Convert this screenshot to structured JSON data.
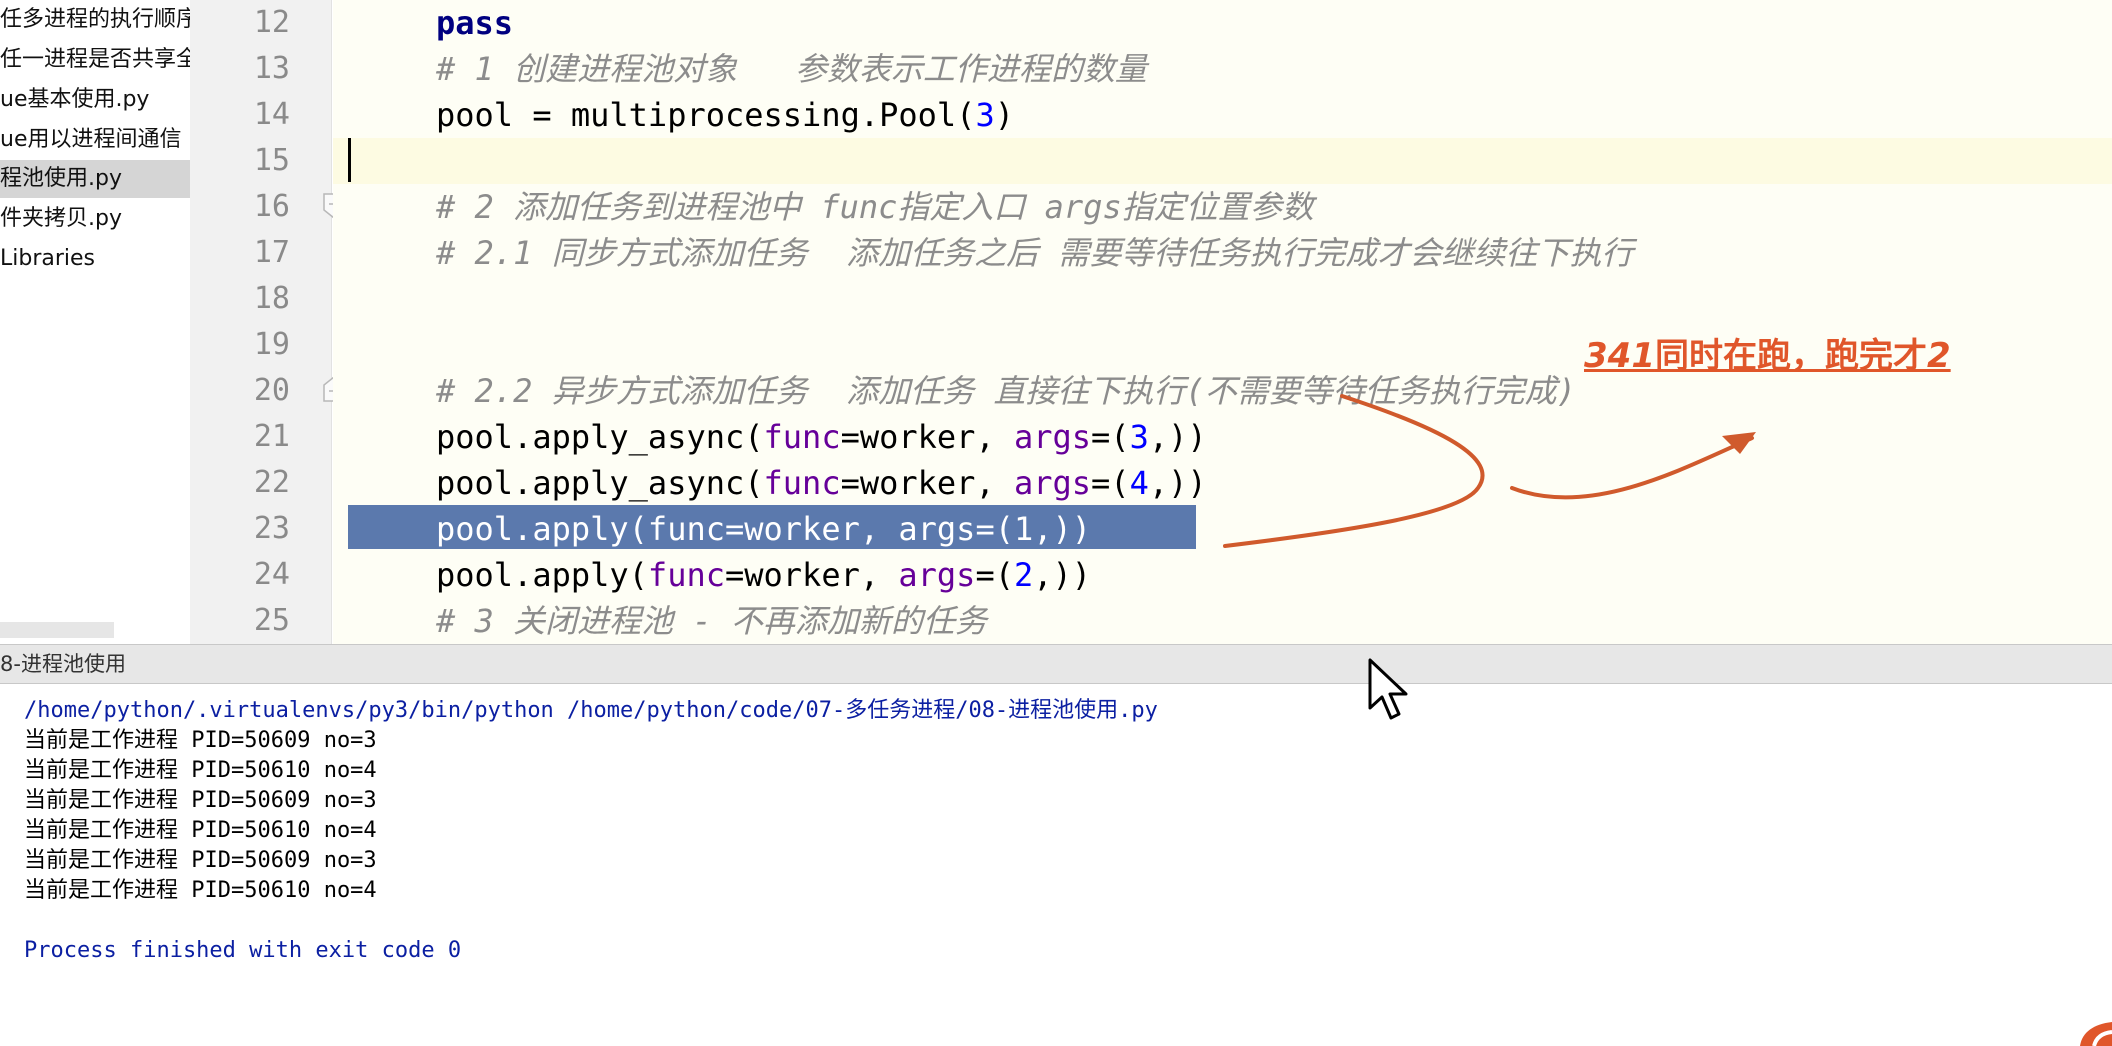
{
  "sidebar": {
    "items": [
      {
        "label": "任多进程的执行顺序"
      },
      {
        "label": "任一进程是否共享全"
      },
      {
        "label": "ue基本使用.py"
      },
      {
        "label": "ue用以进程间通信"
      },
      {
        "label": "程池使用.py",
        "selected": true
      },
      {
        "label": "件夹拷贝.py"
      },
      {
        "label": "Libraries"
      }
    ]
  },
  "editor": {
    "line_numbers": [
      "12",
      "13",
      "14",
      "15",
      "16",
      "17",
      "18",
      "19",
      "20",
      "21",
      "22",
      "23",
      "24",
      "25"
    ],
    "current_line": "15",
    "selected_line": "23",
    "lines": {
      "l12": "pass",
      "l13": "# 1 创建进程池对象   参数表示工作进程的数量",
      "l14_a": "pool = multiprocessing.Pool(",
      "l14_n": "3",
      "l14_b": ")",
      "l16": "# 2 添加任务到进程池中 func指定入口 args指定位置参数",
      "l17": "# 2.1 同步方式添加任务  添加任务之后 需要等待任务执行完成才会继续往下执行",
      "l20": "# 2.2 异步方式添加任务  添加任务 直接往下执行(不需要等待任务执行完成)",
      "l21_a": "pool.apply_async(",
      "l21_f": "func",
      "l21_b": "=worker, ",
      "l21_g": "args",
      "l21_c": "=(",
      "l21_n": "3",
      "l21_d": ",))",
      "l22_a": "pool.apply_async(",
      "l22_f": "func",
      "l22_b": "=worker, ",
      "l22_g": "args",
      "l22_c": "=(",
      "l22_n": "4",
      "l22_d": ",))",
      "l23": "pool.apply(func=worker, args=(1,))",
      "l24_a": "pool.apply(",
      "l24_f": "func",
      "l24_b": "=worker, ",
      "l24_g": "args",
      "l24_c": "=(",
      "l24_n": "2",
      "l24_d": ",))",
      "l25": "# 3 关闭进程池 - 不再添加新的任务"
    }
  },
  "run": {
    "title": "8-进程池使用",
    "command": "/home/python/.virtualenvs/py3/bin/python /home/python/code/07-多任务进程/08-进程池使用.py",
    "output": [
      "当前是工作进程 PID=50609 no=3",
      "当前是工作进程 PID=50610 no=4",
      "当前是工作进程 PID=50609 no=3",
      "当前是工作进程 PID=50610 no=4",
      "当前是工作进程 PID=50609 no=3",
      "当前是工作进程 PID=50610 no=4"
    ],
    "finished": "Process finished with exit code 0"
  },
  "annotation": {
    "text_a": "341",
    "text_b": "同时在跑，跑完才",
    "text_c": "2",
    "color": "#e0562a"
  },
  "colors": {
    "selection": "#5b79ad",
    "keyword": "#000080",
    "number": "#0000ff",
    "param": "#660099",
    "comment": "#8c8c8c",
    "console_blue": "#0b1fa2"
  },
  "icons": [
    "fold-marker-icon",
    "mouse-pointer-icon"
  ]
}
